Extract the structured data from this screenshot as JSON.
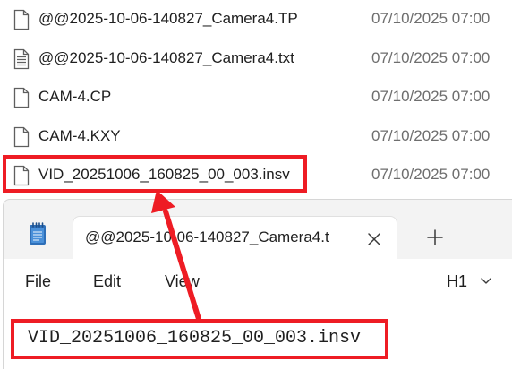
{
  "explorer": {
    "files": [
      {
        "name": "@@2025-10-06-140827_Camera4.TP",
        "date": "07/10/2025 07:00",
        "icon": "blank-file-icon"
      },
      {
        "name": "@@2025-10-06-140827_Camera4.txt",
        "date": "07/10/2025 07:00",
        "icon": "text-file-icon"
      },
      {
        "name": "CAM-4.CP",
        "date": "07/10/2025 07:00",
        "icon": "blank-file-icon"
      },
      {
        "name": "CAM-4.KXY",
        "date": "07/10/2025 07:00",
        "icon": "blank-file-icon"
      },
      {
        "name": "VID_20251006_160825_00_003.insv",
        "date": "07/10/2025 07:00",
        "icon": "blank-file-icon"
      }
    ]
  },
  "notepad": {
    "tab_title": "@@2025-10-06-140827_Camera4.t",
    "menu": {
      "file": "File",
      "edit": "Edit",
      "view": "View",
      "heading": "H1"
    },
    "content": "VID_20251006_160825_00_003.insv"
  },
  "annotation": {
    "color": "#ee1c24"
  }
}
